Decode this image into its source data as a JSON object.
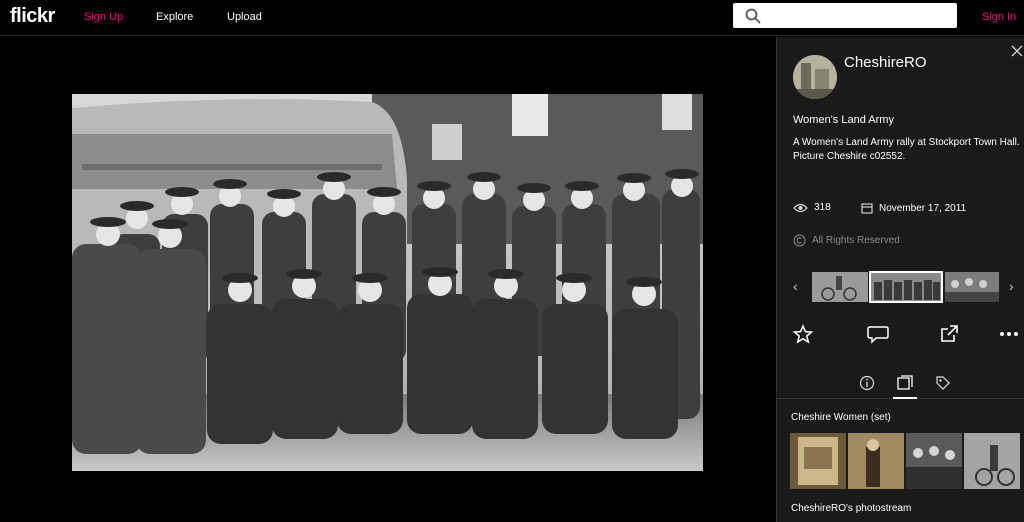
{
  "header": {
    "logo": "flickr",
    "signup": "Sign Up",
    "explore": "Explore",
    "upload": "Upload",
    "search_placeholder": "",
    "signin": "Sign In"
  },
  "photo": {
    "owner": "CheshireRO",
    "title": "Women's Land Army",
    "description_line1": "A Women's Land Army rally at Stockport Town Hall.",
    "description_line2": "Picture Cheshire c02552.",
    "views": "318",
    "date": "November 17, 2011",
    "license": "All Rights Reserved"
  },
  "filmstrip": {
    "prev_icon": "chevron-left-icon",
    "next_icon": "chevron-right-icon"
  },
  "actions": [
    "star-icon",
    "comment-icon",
    "share-icon",
    "more-icon"
  ],
  "tabs": [
    "info-icon",
    "sets-icon",
    "tags-icon"
  ],
  "set": {
    "title": "Cheshire Women (set)"
  },
  "photostream": {
    "title": "CheshireRO's photostream"
  },
  "colors": {
    "accent": "#ff0084",
    "panel_bg": "#1a1a1a",
    "muted": "#8a8a8a"
  }
}
